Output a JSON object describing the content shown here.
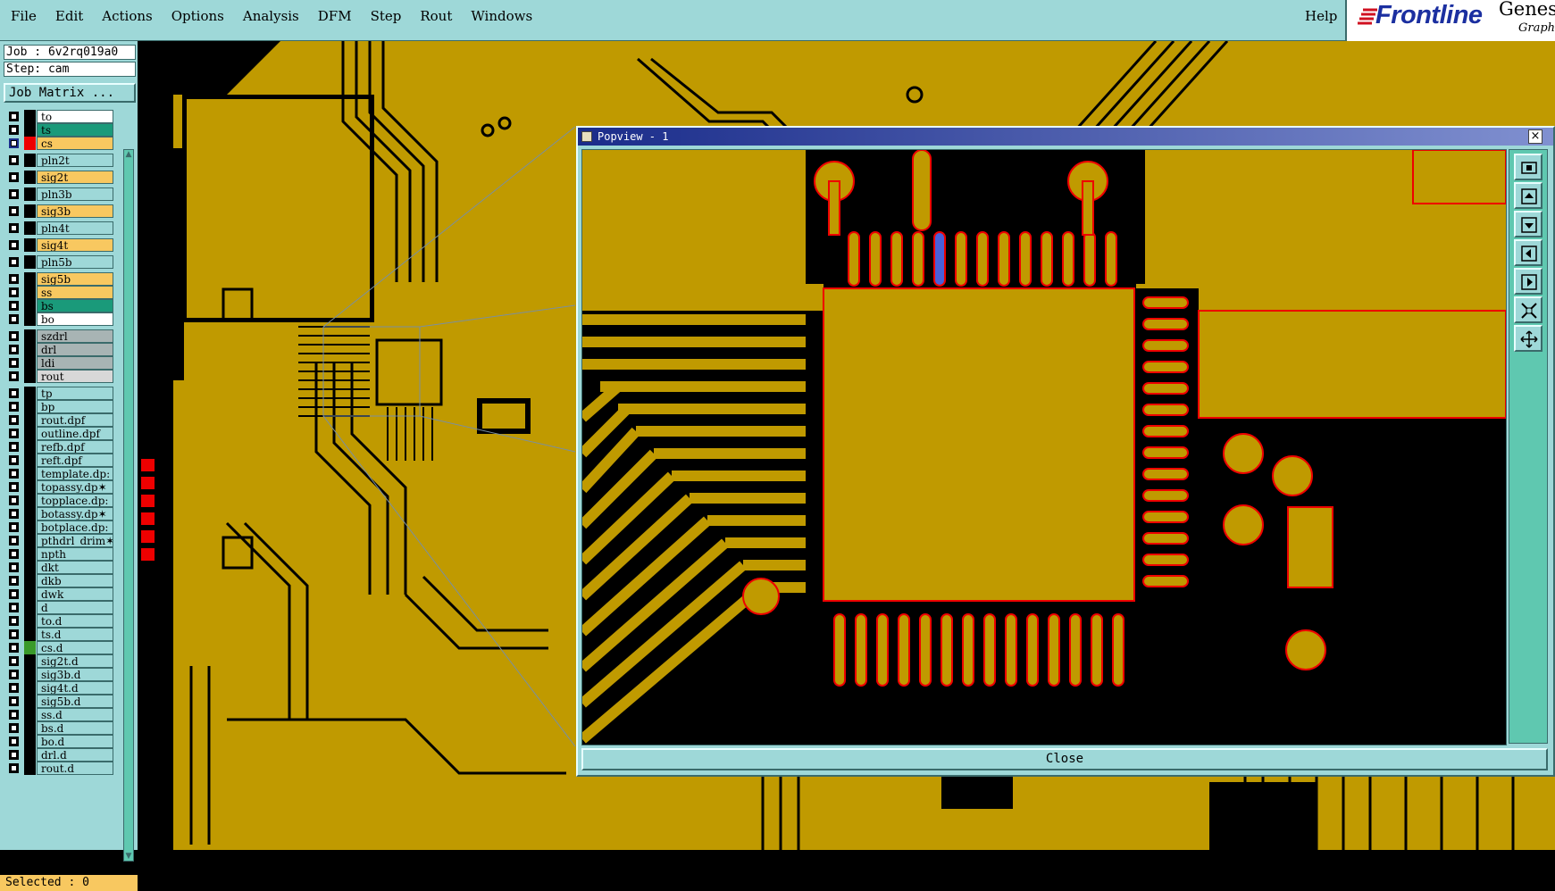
{
  "menu": {
    "items": [
      "File",
      "Edit",
      "Actions",
      "Options",
      "Analysis",
      "DFM",
      "Step",
      "Rout",
      "Windows"
    ],
    "help": "Help"
  },
  "logo": {
    "brand": "Frontline",
    "product": "Genes",
    "tagline": "Graphi"
  },
  "job": {
    "job_line": "Job : 6v2rq019a0",
    "step_line": "Step: cam",
    "matrix_button": "Job Matrix ..."
  },
  "layers": [
    {
      "name": "to",
      "bg": "#ffffff"
    },
    {
      "name": "ts",
      "bg": "#1a9a7a"
    },
    {
      "name": "cs",
      "bg": "#f8c860",
      "active": true
    },
    {
      "name": "pln2t",
      "bg": "#9ed8d8"
    },
    {
      "name": "sig2t",
      "bg": "#f8c860"
    },
    {
      "name": "pln3b",
      "bg": "#9ed8d8"
    },
    {
      "name": "sig3b",
      "bg": "#f8c860"
    },
    {
      "name": "pln4t",
      "bg": "#9ed8d8"
    },
    {
      "name": "sig4t",
      "bg": "#f8c860"
    },
    {
      "name": "pln5b",
      "bg": "#9ed8d8"
    },
    {
      "name": "sig5b",
      "bg": "#f8c860"
    },
    {
      "name": "ss",
      "bg": "#f8c860"
    },
    {
      "name": "bs",
      "bg": "#1a9a7a"
    },
    {
      "name": "bo",
      "bg": "#ffffff"
    },
    {
      "name": "szdrl",
      "bg": "#a8b4b4"
    },
    {
      "name": "drl",
      "bg": "#a8b4b4"
    },
    {
      "name": "ldi",
      "bg": "#a8b4b4"
    },
    {
      "name": "rout",
      "bg": "#d8d8d8"
    },
    {
      "name": "tp",
      "bg": "#9ed8d8"
    },
    {
      "name": "bp",
      "bg": "#9ed8d8"
    },
    {
      "name": "rout.dpf",
      "bg": "#9ed8d8"
    },
    {
      "name": "outline.dpf",
      "bg": "#9ed8d8"
    },
    {
      "name": "refb.dpf",
      "bg": "#9ed8d8"
    },
    {
      "name": "reft.dpf",
      "bg": "#9ed8d8"
    },
    {
      "name": "template.dp:",
      "bg": "#9ed8d8"
    },
    {
      "name": "topassy.dp✶",
      "bg": "#9ed8d8"
    },
    {
      "name": "topplace.dp:",
      "bg": "#9ed8d8"
    },
    {
      "name": "botassy.dp✶",
      "bg": "#9ed8d8"
    },
    {
      "name": "botplace.dp:",
      "bg": "#9ed8d8"
    },
    {
      "name": "pthdrl_drim✶",
      "bg": "#9ed8d8"
    },
    {
      "name": "npth",
      "bg": "#9ed8d8"
    },
    {
      "name": "dkt",
      "bg": "#9ed8d8"
    },
    {
      "name": "dkb",
      "bg": "#9ed8d8"
    },
    {
      "name": "dwk",
      "bg": "#9ed8d8"
    },
    {
      "name": "d",
      "bg": "#9ed8d8"
    },
    {
      "name": "to.d",
      "bg": "#9ed8d8"
    },
    {
      "name": "ts.d",
      "bg": "#9ed8d8"
    },
    {
      "name": "cs.d",
      "bg": "#9ed8d8",
      "green": true
    },
    {
      "name": "sig2t.d",
      "bg": "#9ed8d8"
    },
    {
      "name": "sig3b.d",
      "bg": "#9ed8d8"
    },
    {
      "name": "sig4t.d",
      "bg": "#9ed8d8"
    },
    {
      "name": "sig5b.d",
      "bg": "#9ed8d8"
    },
    {
      "name": "ss.d",
      "bg": "#9ed8d8"
    },
    {
      "name": "bs.d",
      "bg": "#9ed8d8"
    },
    {
      "name": "bo.d",
      "bg": "#9ed8d8"
    },
    {
      "name": "drl.d",
      "bg": "#9ed8d8"
    },
    {
      "name": "rout.d",
      "bg": "#9ed8d8"
    }
  ],
  "status": {
    "selected": "Selected : 0"
  },
  "popview": {
    "title": "Popview - 1",
    "close_button": "Close",
    "close_x": "×"
  },
  "colors": {
    "copper": "#c09a00",
    "substrate": "#000000",
    "outline": "#e00000",
    "highlight": "#4a5fd8",
    "panel": "#9ed8d8"
  }
}
